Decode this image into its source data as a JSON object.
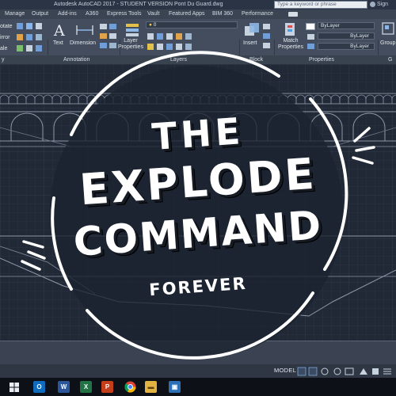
{
  "window": {
    "title": "Autodesk AutoCAD 2017 - STUDENT VERSION    Pont Du Guard.dwg",
    "search_placeholder": "Type a keyword or phrase",
    "sign_in": "Sign"
  },
  "ribbon_tabs": [
    "Manage",
    "Output",
    "Add-ins",
    "A360",
    "Express Tools",
    "Vault",
    "Featured Apps",
    "BIM 360",
    "Performance"
  ],
  "ribbon": {
    "modify_items": [
      "otate",
      "irror",
      "ale"
    ],
    "text_label": "Text",
    "dimension_label": "Dimension",
    "layer_properties_label": "Layer Properties",
    "layer_value": "0",
    "insert_label": "Insert",
    "match_properties_label": "Match Properties",
    "bylayer_1": "ByLayer",
    "bylayer_2": "ByLayer",
    "bylayer_3": "ByLayer",
    "group_label": "Group",
    "panels": {
      "modify_partial": "y",
      "annotation": "Annotation",
      "layers": "Layers",
      "block": "Block",
      "properties": "Properties",
      "groups_partial": "G"
    }
  },
  "overlay": {
    "line1": "THE",
    "line2": "EXPLODE",
    "line3": "COMMAND",
    "line4": "FOREVER"
  },
  "status_bar": {
    "model_label": "MODEL"
  },
  "taskbar": {
    "apps": [
      "outlook-icon",
      "word-icon",
      "excel-icon",
      "powerpoint-icon",
      "chrome-icon",
      "folder-icon",
      "photos-icon",
      "store-icon"
    ]
  },
  "colors": {
    "canvas_bg": "#212836",
    "ribbon_bg": "#434d5d",
    "overlay_text": "#ffffff"
  }
}
